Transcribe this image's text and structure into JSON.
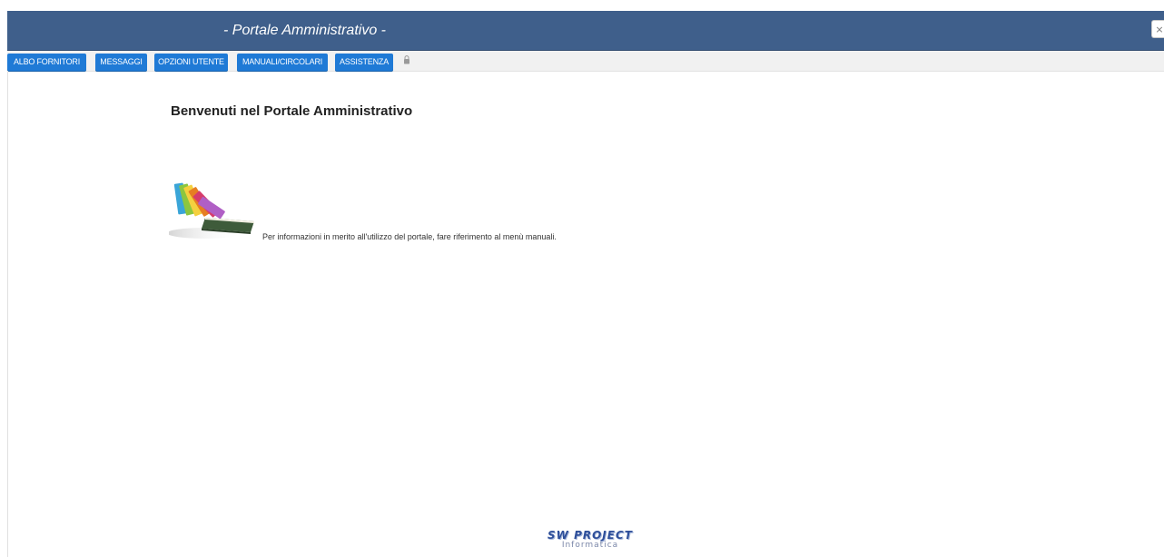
{
  "header": {
    "title": "- Portale Amministrativo -",
    "close_glyph": "×",
    "background_color": "#3f5f8b"
  },
  "menu": {
    "items": [
      {
        "label": "ALBO FORNITORI"
      },
      {
        "label": "MESSAGGI"
      },
      {
        "label": "OPZIONI UTENTE"
      },
      {
        "label": "MANUALI/CIRCOLARI"
      },
      {
        "label": "ASSISTENZA"
      }
    ],
    "button_color": "#1f7ad6",
    "icon": "lock-icon"
  },
  "main": {
    "welcome_title": "Benvenuti nel Portale Amministrativo",
    "info_text": "Per informazioni in merito all'utilizzo del portale, fare riferimento al menù manuali.",
    "illustration": "books-icon"
  },
  "footer": {
    "logo_main": "SW PROJECT",
    "logo_sub": "Informatica"
  }
}
